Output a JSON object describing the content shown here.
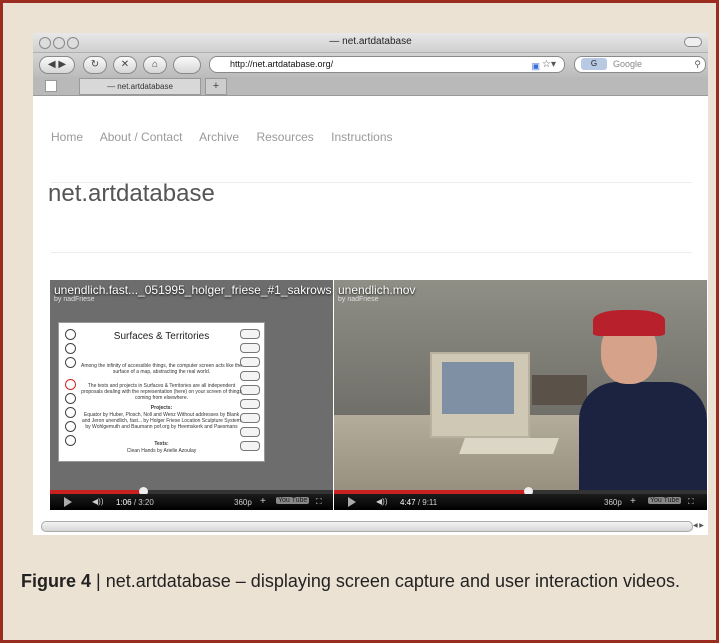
{
  "browser": {
    "window_title": "— net.artdatabase",
    "url": "http://net.artdatabase.org/",
    "search_placeholder": "Google",
    "search_engine_label": "G",
    "tab_label": "— net.artdatabase",
    "new_tab": "+",
    "rss_icon": "rss-icon"
  },
  "site": {
    "nav": [
      "Home",
      "About / Contact",
      "Archive",
      "Resources",
      "Instructions"
    ],
    "title": "net.artdatabase"
  },
  "video1": {
    "title": "unendlich.fast..._051995_holger_friese_#1_sakrows",
    "by": "by nadFriese",
    "doc_title": "Surfaces & Territories",
    "doc_text1": "Among the infinity of accessible things, the computer screen acts like the surface of a map, abstracting the real world.",
    "doc_text2": "The texts and projects in Surfaces & Territories are all independent proposals dealing with the representation (here) on your screen of things coming from elsewhere.",
    "doc_projects_heading": "Projects:",
    "doc_projects": "Equator by Huber, Plosch, Noll and Wenz  Without addresses by Blank and Jeron  unendlich, fast... by Holger Friese  Location Sculpture System by Wohlgemuth and Baumann  pof.org by Heemskerk and Paesmans",
    "doc_texts_heading": "Texts:",
    "doc_texts": "Clean Hands by Arielle Azoulay",
    "time_current": "1:06",
    "time_total": "/ 3:20",
    "quality": "360p",
    "progress": 0.33
  },
  "video2": {
    "title": "unendlich.mov",
    "by": "by nadFriese",
    "time_current": "4:47",
    "time_total": "/ 9:11",
    "quality": "360p",
    "progress": 0.52
  },
  "player": {
    "youtube_label": "You Tube",
    "plus": "+",
    "fullscreen": "⛶",
    "volume": "◀))"
  },
  "caption": {
    "label": "Figure 4",
    "separator": " | ",
    "text": "net.artdatabase – displaying screen capture and user interaction videos."
  }
}
